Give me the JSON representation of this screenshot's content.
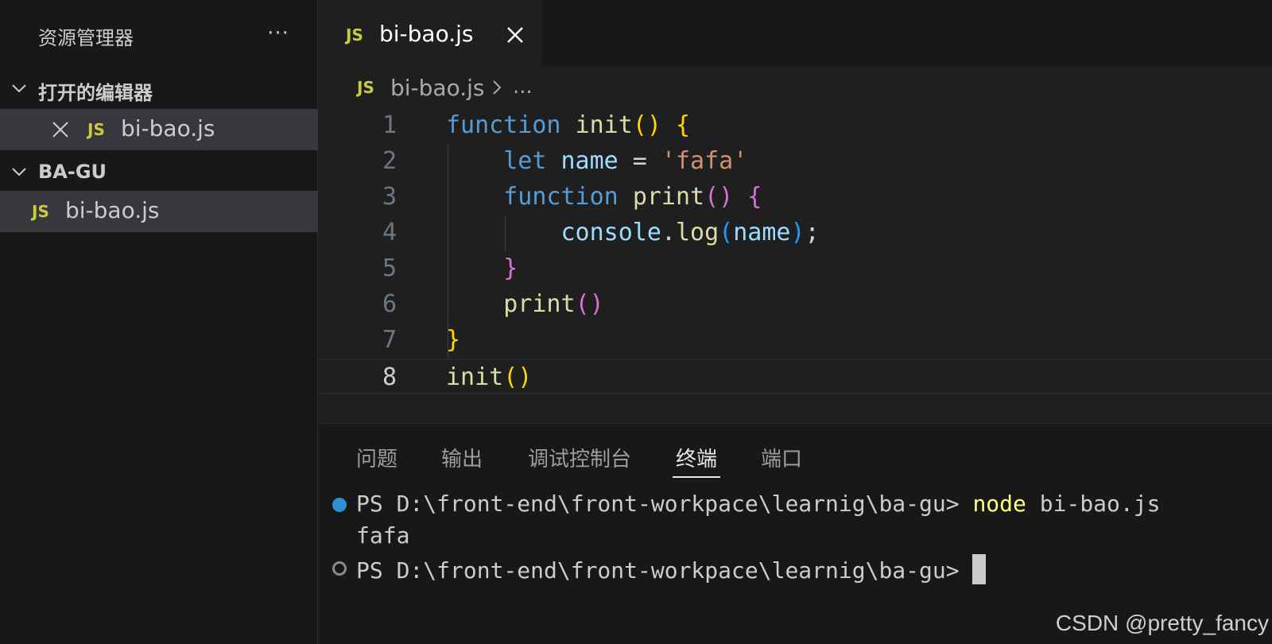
{
  "sidebar": {
    "title": "资源管理器",
    "more_label": "···",
    "open_editors": {
      "label": "打开的编辑器",
      "items": [
        {
          "badge": "JS",
          "name": "bi-bao.js"
        }
      ]
    },
    "folder": {
      "label": "BA-GU",
      "items": [
        {
          "badge": "JS",
          "name": "bi-bao.js"
        }
      ]
    }
  },
  "tabs": [
    {
      "badge": "JS",
      "label": "bi-bao.js",
      "active": true
    }
  ],
  "breadcrumb": {
    "badge": "JS",
    "file": "bi-bao.js",
    "more": "..."
  },
  "editor": {
    "line_numbers": [
      "1",
      "2",
      "3",
      "4",
      "5",
      "6",
      "7",
      "8"
    ],
    "current_line": 8,
    "lines": [
      [
        {
          "t": "function",
          "c": "kw"
        },
        {
          "t": " ",
          "c": ""
        },
        {
          "t": "init",
          "c": "fn"
        },
        {
          "t": "()",
          "c": "p1"
        },
        {
          "t": " ",
          "c": ""
        },
        {
          "t": "{",
          "c": "p1"
        }
      ],
      [
        {
          "t": "    ",
          "c": ""
        },
        {
          "t": "let",
          "c": "kw"
        },
        {
          "t": " ",
          "c": ""
        },
        {
          "t": "name",
          "c": "var"
        },
        {
          "t": " = ",
          "c": "op"
        },
        {
          "t": "'fafa'",
          "c": "str"
        }
      ],
      [
        {
          "t": "    ",
          "c": ""
        },
        {
          "t": "function",
          "c": "kw"
        },
        {
          "t": " ",
          "c": ""
        },
        {
          "t": "print",
          "c": "fn"
        },
        {
          "t": "()",
          "c": "p2"
        },
        {
          "t": " ",
          "c": ""
        },
        {
          "t": "{",
          "c": "p2"
        }
      ],
      [
        {
          "t": "        ",
          "c": ""
        },
        {
          "t": "console",
          "c": "var"
        },
        {
          "t": ".",
          "c": "op"
        },
        {
          "t": "log",
          "c": "fn"
        },
        {
          "t": "(",
          "c": "p3"
        },
        {
          "t": "name",
          "c": "var"
        },
        {
          "t": ")",
          "c": "p3"
        },
        {
          "t": ";",
          "c": "op"
        }
      ],
      [
        {
          "t": "    ",
          "c": ""
        },
        {
          "t": "}",
          "c": "p2"
        }
      ],
      [
        {
          "t": "    ",
          "c": ""
        },
        {
          "t": "print",
          "c": "fn"
        },
        {
          "t": "()",
          "c": "p2"
        }
      ],
      [
        {
          "t": "}",
          "c": "p1"
        }
      ],
      [
        {
          "t": "init",
          "c": "fn"
        },
        {
          "t": "()",
          "c": "p1"
        }
      ]
    ]
  },
  "panel": {
    "tabs": [
      "问题",
      "输出",
      "调试控制台",
      "终端",
      "端口"
    ],
    "active_tab": "终端",
    "terminal": {
      "line1_prompt": "PS D:\\front-end\\front-workpace\\learnig\\ba-gu> ",
      "line1_cmd": "node",
      "line1_args": " bi-bao.js",
      "output": "fafa",
      "line3_prompt": "PS D:\\front-end\\front-workpace\\learnig\\ba-gu> "
    }
  },
  "watermark": "CSDN @pretty_fancy",
  "colors": {
    "js_badge": "#cbcb41",
    "keyword": "#569cd6",
    "function": "#dcdcaa",
    "variable": "#9cdcfe",
    "string": "#ce9178",
    "terminal_cmd": "#ffff80"
  }
}
